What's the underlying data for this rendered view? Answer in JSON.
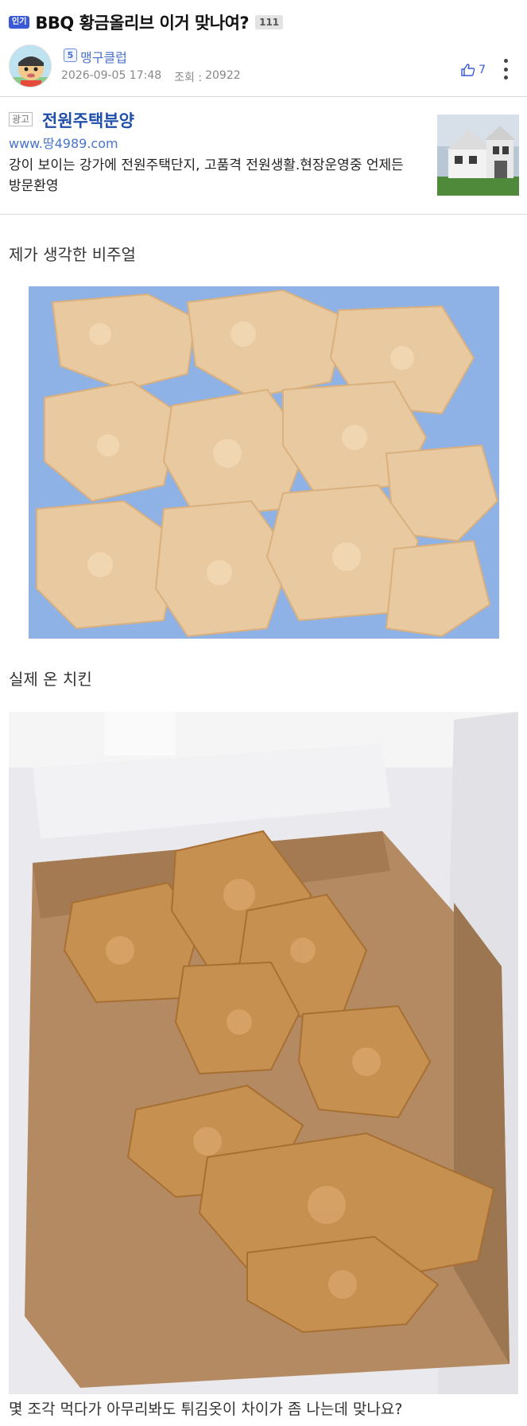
{
  "post": {
    "badge": "인기",
    "title": "BBQ 황금올리브 이거 맞나여?",
    "comment_count": "111"
  },
  "author": {
    "level": "5",
    "nickname": "맹구클럽",
    "date": "2026-09-05 17:48",
    "views_label": "조회 :",
    "views": "20922",
    "likes": "7"
  },
  "ad": {
    "tag": "광고",
    "title": "전원주택분양",
    "url": "www.땅4989.com",
    "description": "강이 보이는 강가에 전원주택단지, 고품격 전원생활.현장운영중 언제든 방문환영"
  },
  "body": {
    "caption_expected": "제가 생각한 비주얼",
    "caption_actual": "실제 온 치킨",
    "closing_text": "몇 조각 먹다가 아무리봐도 튀김옷이 차이가 좀 나는데 맞나요?"
  },
  "colors": {
    "badge_blue": "#3a59d6",
    "link_blue": "#4a6fc8",
    "ad_title_blue": "#1f4fa8"
  },
  "icons": [
    "thumbs-up-icon",
    "more-vertical-icon",
    "level-badge-icon"
  ]
}
